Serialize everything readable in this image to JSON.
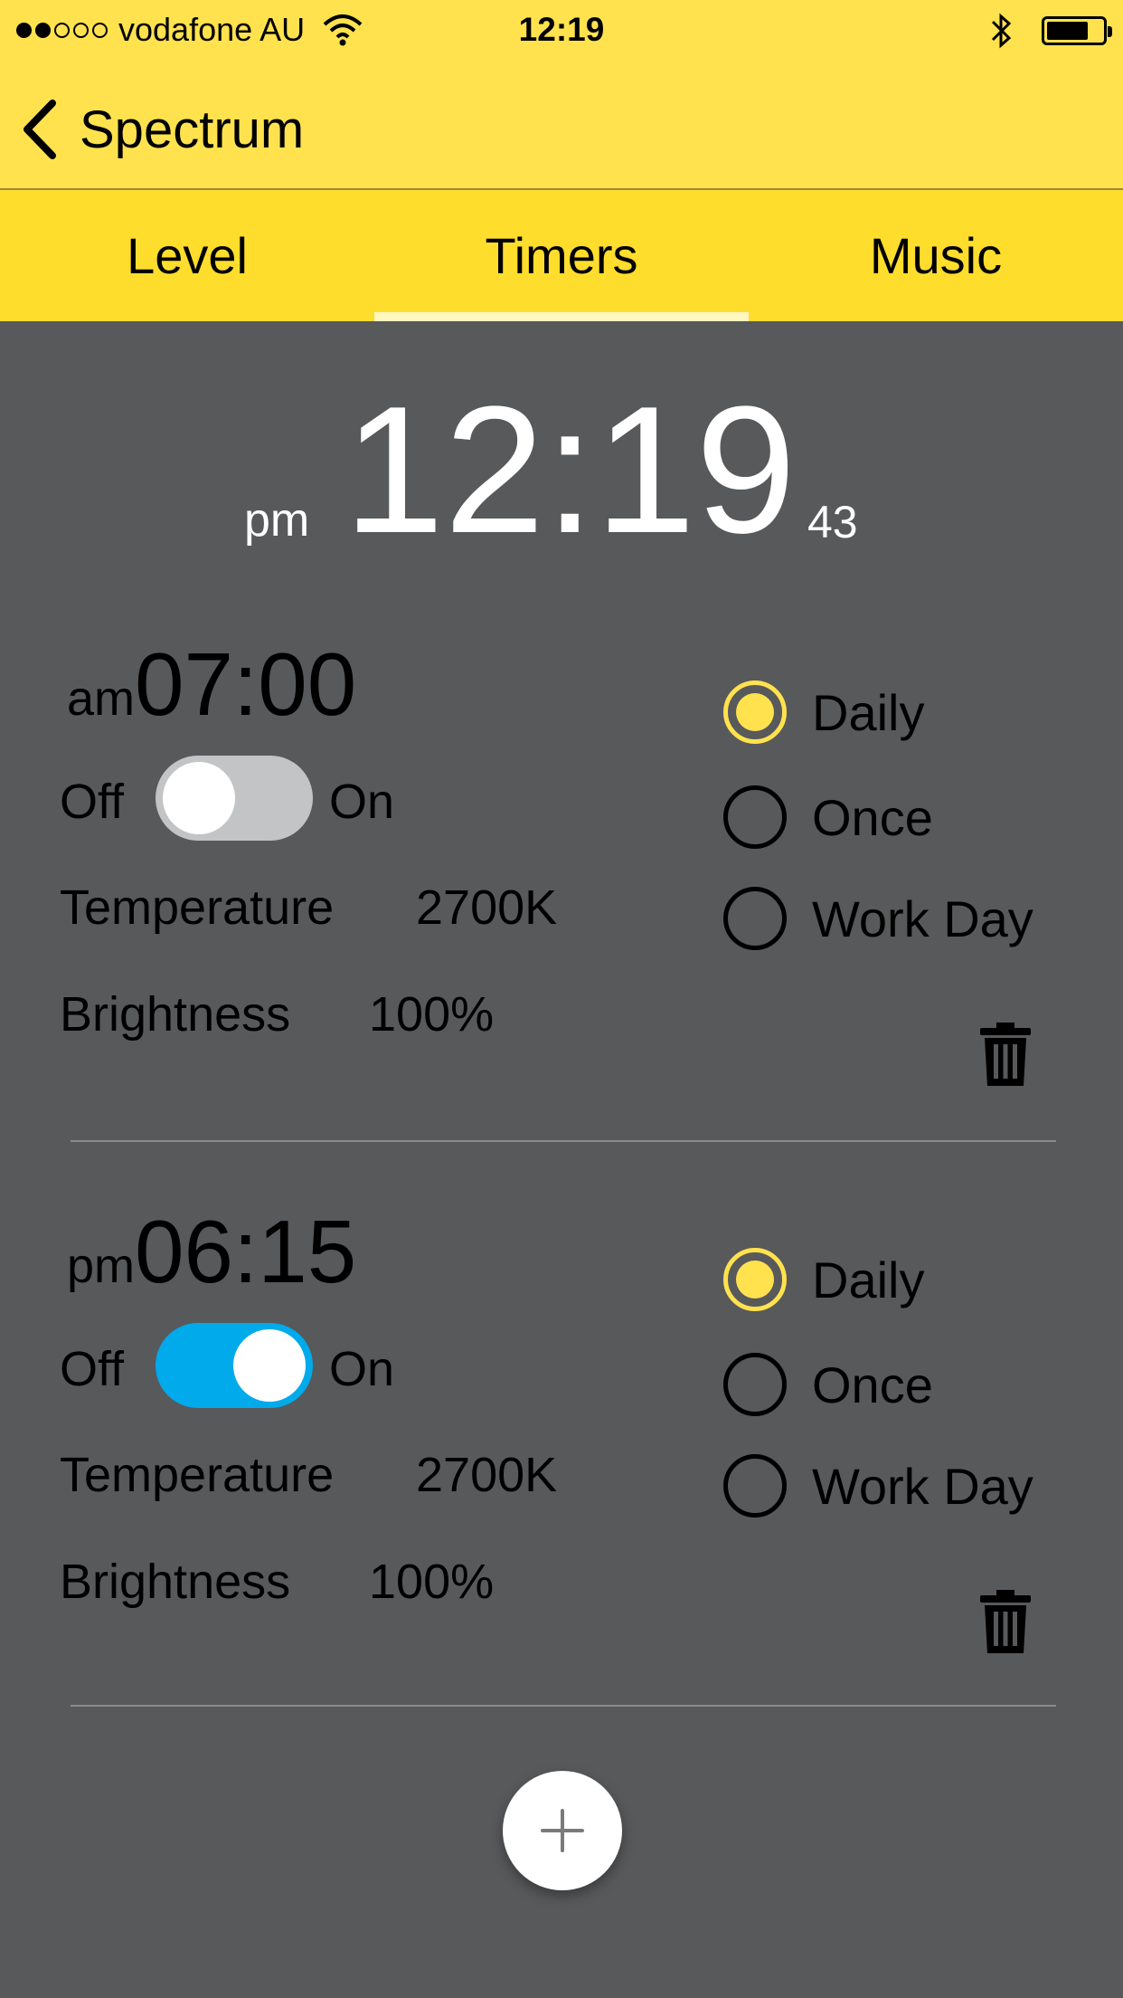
{
  "status_bar": {
    "signal_dots": [
      true,
      true,
      false,
      false,
      false
    ],
    "carrier": "vodafone AU",
    "time": "12:19",
    "battery_level": 0.75
  },
  "nav": {
    "back_label": "Spectrum"
  },
  "tabs": [
    {
      "label": "Level",
      "active": false
    },
    {
      "label": "Timers",
      "active": true
    },
    {
      "label": "Music",
      "active": false
    }
  ],
  "clock": {
    "ampm": "pm",
    "time": "12:19",
    "seconds": "43"
  },
  "labels": {
    "off": "Off",
    "on": "On",
    "temperature": "Temperature",
    "brightness": "Brightness",
    "options": [
      "Daily",
      "Once",
      "Work Day"
    ]
  },
  "timers": [
    {
      "ampm": "am",
      "time": "07:00",
      "enabled": false,
      "temperature": "2700K",
      "brightness": "100%",
      "selected_option": "Daily"
    },
    {
      "ampm": "pm",
      "time": "06:15",
      "enabled": true,
      "temperature": "2700K",
      "brightness": "100%",
      "selected_option": "Daily"
    }
  ],
  "colors": {
    "accent_yellow": "#ffe24e",
    "tab_yellow": "#ffdd2c",
    "toggle_on": "#00aaeb",
    "background": "#58595b"
  },
  "icons": {
    "back": "chevron-left-icon",
    "delete": "trash-icon",
    "add": "plus-icon",
    "wifi": "wifi-icon",
    "bluetooth": "bluetooth-icon"
  }
}
